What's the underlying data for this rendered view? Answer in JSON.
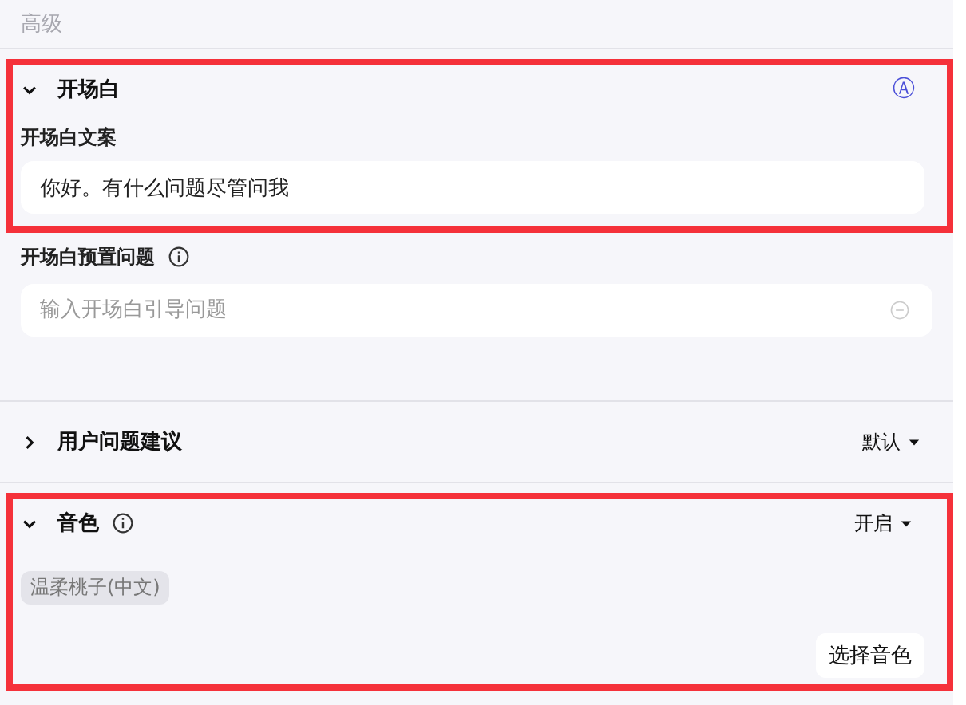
{
  "header": {
    "title": "高级"
  },
  "sections": [
    {
      "title": "开场白",
      "expanded": true,
      "highlighted": true,
      "badge": "Ⓐ",
      "fields": [
        {
          "label": "开场白文案",
          "value": "你好。有什么问题尽管问我"
        }
      ]
    },
    {
      "highlighted": false,
      "fields": [
        {
          "label": "开场白预置问题",
          "placeholder": "输入开场白引导问题",
          "info": true,
          "removable": true
        }
      ]
    },
    {
      "title": "用户问题建议",
      "expanded": false,
      "highlighted": false,
      "dropdown": "默认"
    },
    {
      "title": "音色",
      "expanded": true,
      "highlighted": true,
      "info": true,
      "dropdown": "开启",
      "tags": [
        "温柔桃子(中文)"
      ],
      "button": "选择音色"
    }
  ]
}
